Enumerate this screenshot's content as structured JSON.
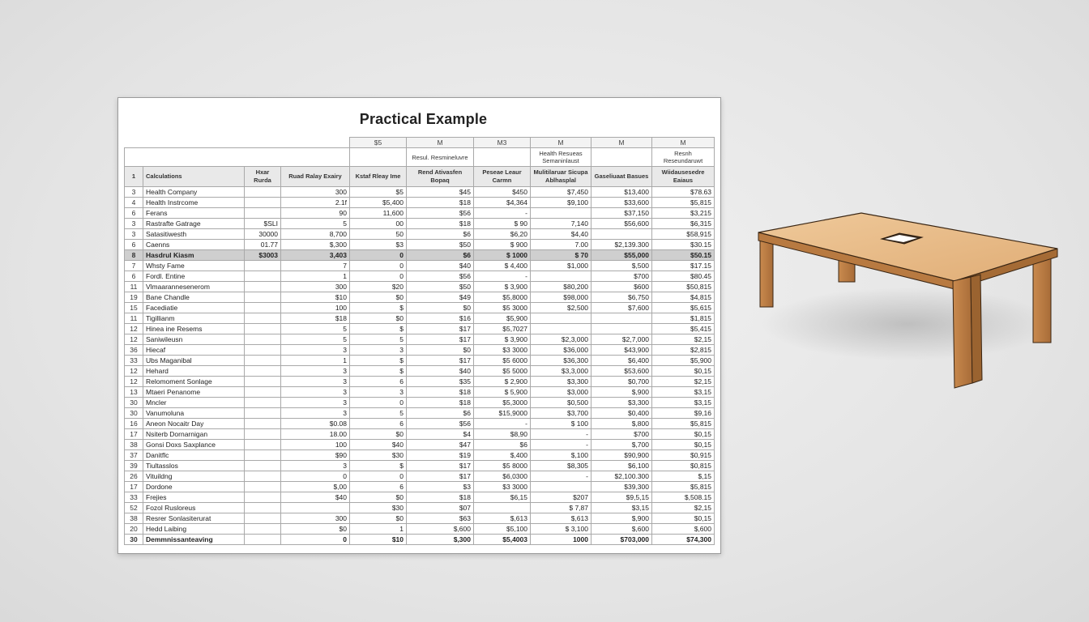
{
  "document": {
    "title": "Practical Example"
  },
  "spreadsheet": {
    "top_letters": [
      "$5",
      "M",
      "M3",
      "M",
      "M",
      "M"
    ],
    "subheaders": [
      "",
      "Resul. Resmineluvre",
      "",
      "Health Resueas Semaninlaust",
      "",
      "Resnh Reseundaruwt"
    ],
    "header_row_number": "1",
    "headers": [
      "Calculations",
      "Hxar Rurda",
      "Ruad Ralay Exairy",
      "Kstaf Rleay Ime",
      "Rend Ativasfen Bopaq",
      "Peseae Leaur Carmn",
      "Mulitilaruar Sicupa Ablhasplal",
      "Gaseliuaat Basues",
      "Wiidausesedre Eaiaus"
    ],
    "rows": [
      {
        "n": "3",
        "cells": [
          "Health Company",
          "",
          "300",
          "$5",
          "$45",
          "$450",
          "$7,450",
          "$13,400",
          "$78.63"
        ]
      },
      {
        "n": "4",
        "cells": [
          "Health Instrcome",
          "",
          "2.1f",
          "$5,400",
          "$18",
          "$4,364",
          "$9,100",
          "$33,600",
          "$5,815"
        ]
      },
      {
        "n": "6",
        "cells": [
          "Ferans",
          "",
          "90",
          "11,600",
          "$56",
          "-",
          "",
          "$37,150",
          "$3,215"
        ]
      },
      {
        "n": "3",
        "cells": [
          "Rastrafte Gatrage",
          "$SLI",
          "5",
          "00",
          "$18",
          "$ 90",
          "7,140",
          "$56,600",
          "$6,315"
        ]
      },
      {
        "n": "3",
        "cells": [
          "Satasitiwesth",
          "30000",
          "8,700",
          "50",
          "$6",
          "$6,20",
          "$4,40",
          "",
          "$58,915"
        ]
      },
      {
        "n": "6",
        "cells": [
          "Caenns",
          "01.77",
          "$,300",
          "$3",
          "$50",
          "$ 900",
          "7.00",
          "$2,139.300",
          "$30.15"
        ]
      },
      {
        "n": "8",
        "cells": [
          "Hasdrul Kiasm",
          "$3003",
          "3,403",
          "0",
          "$6",
          "$ 1000",
          "$ 70",
          "$55,000",
          "$50.15"
        ],
        "highlight": true
      },
      {
        "n": "7",
        "cells": [
          "Whsty Fame",
          "",
          "7",
          "0",
          "$40",
          "$ 4,400",
          "$1,000",
          "$,500",
          "$17.15"
        ]
      },
      {
        "n": "6",
        "cells": [
          "Fordl. Entine",
          "",
          "1",
          "0",
          "$56",
          "-",
          "",
          "$700",
          "$80.45"
        ]
      },
      {
        "n": "11",
        "cells": [
          "Vlmaarannesenerom",
          "",
          "300",
          "$20",
          "$50",
          "$ 3,900",
          "$80,200",
          "$600",
          "$50,815"
        ]
      },
      {
        "n": "19",
        "cells": [
          "Bane Chandle",
          "",
          "$10",
          "$0",
          "$49",
          "$5,8000",
          "$98,000",
          "$6,750",
          "$4,815"
        ]
      },
      {
        "n": "15",
        "cells": [
          "Facediatie",
          "",
          "100",
          "$",
          "$0",
          "$5 3000",
          "$2,500",
          "$7,600",
          "$5,615"
        ]
      },
      {
        "n": "11",
        "cells": [
          "Tigillianm",
          "",
          "$18",
          "$0",
          "$16",
          "$5,900",
          "",
          "",
          "$1,815"
        ]
      },
      {
        "n": "12",
        "cells": [
          "Hinea ine Resems",
          "",
          "5",
          "$",
          "$17",
          "$5,7027",
          "",
          "",
          "$5,415"
        ]
      },
      {
        "n": "12",
        "cells": [
          "Saniwileusn",
          "",
          "5",
          "5",
          "$17",
          "$ 3,900",
          "$2,3,000",
          "$2,7,000",
          "$2,15"
        ]
      },
      {
        "n": "36",
        "cells": [
          "Hiecaf",
          "",
          "3",
          "3",
          "$0",
          "$3 3000",
          "$36,000",
          "$43,900",
          "$2,815"
        ]
      },
      {
        "n": "33",
        "cells": [
          "Ubs Maganibal",
          "",
          "1",
          "$",
          "$17",
          "$5 6000",
          "$36,300",
          "$6,400",
          "$5,900"
        ]
      },
      {
        "n": "12",
        "cells": [
          "Hehard",
          "",
          "3",
          "$",
          "$40",
          "$5 5000",
          "$3,3,000",
          "$53,600",
          "$0,15"
        ]
      },
      {
        "n": "12",
        "cells": [
          "Relomoment Sonlage",
          "",
          "3",
          "6",
          "$35",
          "$ 2,900",
          "$3,300",
          "$0,700",
          "$2,15"
        ]
      },
      {
        "n": "13",
        "cells": [
          "Mtaeri Penanome",
          "",
          "3",
          "3",
          "$18",
          "$ 5,900",
          "$3,000",
          "$,900",
          "$3,15"
        ]
      },
      {
        "n": "30",
        "cells": [
          "Mncler",
          "",
          "3",
          "0",
          "$18",
          "$5,3000",
          "$0,500",
          "$3,300",
          "$3,15"
        ]
      },
      {
        "n": "30",
        "cells": [
          "Vanumoluna",
          "",
          "3",
          "5",
          "$6",
          "$15,9000",
          "$3,700",
          "$0,400",
          "$9,16"
        ]
      },
      {
        "n": "16",
        "cells": [
          "Aneon Nocaitr Day",
          "",
          "$0.08",
          "6",
          "$56",
          "-",
          "$ 100",
          "$,800",
          "$5,815"
        ]
      },
      {
        "n": "17",
        "cells": [
          "Nsiterb Dornarnigan",
          "",
          "18.00",
          "$0",
          "$4",
          "$8,90",
          "-",
          "$700",
          "$0,15"
        ]
      },
      {
        "n": "38",
        "cells": [
          "Gonsi Doxs Saxplance",
          "",
          "100",
          "$40",
          "$47",
          "$6",
          "-",
          "$,700",
          "$0,15"
        ]
      },
      {
        "n": "37",
        "cells": [
          "Danitflc",
          "",
          "$90",
          "$30",
          "$19",
          "$,400",
          "$,100",
          "$90,900",
          "$0,915"
        ]
      },
      {
        "n": "39",
        "cells": [
          "Tiultasslos",
          "",
          "3",
          "$",
          "$17",
          "$5 8000",
          "$8,305",
          "$6,100",
          "$0,815"
        ]
      },
      {
        "n": "26",
        "cells": [
          "Vituildng",
          "",
          "0",
          "0",
          "$17",
          "$6,0300",
          "-",
          "$2,100.300",
          "$,15"
        ]
      },
      {
        "n": "17",
        "cells": [
          "Dordone",
          "",
          "$,00",
          "6",
          "$3",
          "$3 3000",
          "",
          "$39,300",
          "$5,815"
        ]
      },
      {
        "n": "33",
        "cells": [
          "Frejies",
          "",
          "$40",
          "$0",
          "$18",
          "$6,15",
          "$207",
          "$9,5,15",
          "$,508.15"
        ]
      },
      {
        "n": "52",
        "cells": [
          "Fozol Rusloreus",
          "",
          "",
          "$30",
          "$07",
          "",
          "$ 7,87",
          "$3,15",
          "$2,15"
        ]
      },
      {
        "n": "38",
        "cells": [
          "Resrer Sonlasiterurat",
          "",
          "300",
          "$0",
          "$63",
          "$,613",
          "$,613",
          "$,900",
          "$0,15"
        ]
      },
      {
        "n": "20",
        "cells": [
          "Hedd Laibing",
          "",
          "$0",
          "1",
          "$,600",
          "$5,100",
          "$ 3,100",
          "$,600",
          "$,600"
        ]
      }
    ],
    "total": {
      "n": "30",
      "cells": [
        "Demmnissanteaving",
        "",
        "0",
        "$10",
        "$,300",
        "$5,4003",
        "1000",
        "$703,000",
        "$74,300"
      ]
    }
  }
}
